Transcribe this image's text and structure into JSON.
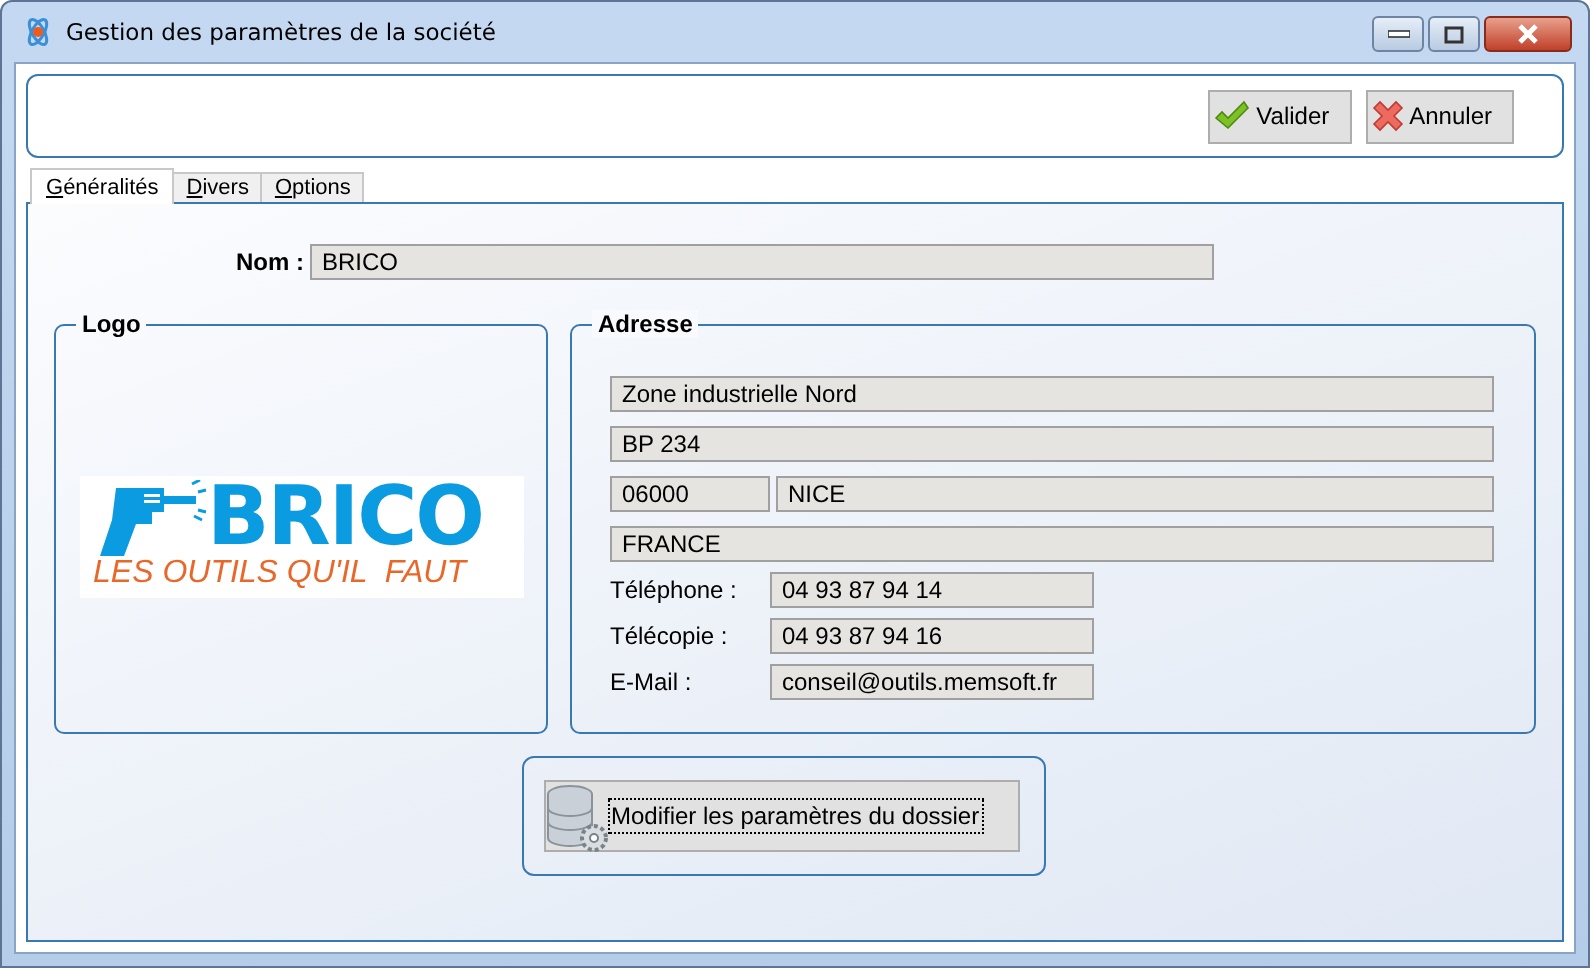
{
  "window": {
    "title": "Gestion des paramètres de la société"
  },
  "toolbar": {
    "buttons": [
      {
        "kind": "ok",
        "label": "Valider"
      },
      {
        "kind": "cancel",
        "label": "Annuler"
      }
    ]
  },
  "tabs": [
    {
      "label": "Généralités",
      "selected": true
    },
    {
      "label": "Divers",
      "selected": false
    },
    {
      "label": "Options",
      "selected": false
    }
  ],
  "name": {
    "label": "Nom :",
    "value": "BRICO"
  },
  "logo": {
    "title": "Logo",
    "brand": "BRICO",
    "tagline": "LES OUTILS QU'IL  FAUT"
  },
  "address": {
    "title": "Adresse",
    "line1": "Zone industrielle Nord",
    "line2": "BP 234",
    "postcode": "06000",
    "city": "NICE",
    "country": "FRANCE",
    "contacts": [
      {
        "label": "Téléphone :",
        "value": "04 93 87 94 14"
      },
      {
        "label": "Télécopie :",
        "value": "04 93 87 94 16"
      },
      {
        "label": "E-Mail :",
        "value": "conseil@outils.memsoft.fr"
      }
    ]
  },
  "folder_button": {
    "label": "Modifier les paramètres du dossier"
  }
}
